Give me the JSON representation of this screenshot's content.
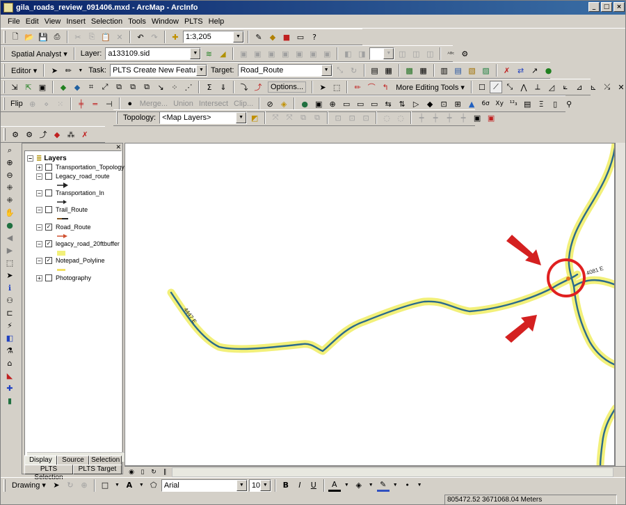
{
  "window": {
    "title": "gila_roads_review_091406.mxd - ArcMap - ArcInfo",
    "min": "_",
    "max": "□",
    "close": "×"
  },
  "menu": [
    "File",
    "Edit",
    "View",
    "Insert",
    "Selection",
    "Tools",
    "Window",
    "PLTS",
    "Help"
  ],
  "standard_toolbar": {
    "scale": "1:3,205"
  },
  "spatial_analyst": {
    "label": "Spatial Analyst ▾",
    "layer_label": "Layer:",
    "layer_value": "a133109.sid"
  },
  "editor": {
    "label": "Editor ▾",
    "task_label": "Task:",
    "task_value": "PLTS Create New Feature",
    "target_label": "Target:",
    "target_value": "Road_Route"
  },
  "edit_tools": {
    "options": "Options...",
    "more_editing": "More Editing Tools ▾"
  },
  "advanced_edit": {
    "flip": "Flip",
    "merge": "Merge...",
    "union": "Union",
    "intersect": "Intersect",
    "clip": "Clip..."
  },
  "topology": {
    "label": "Topology:",
    "value": "<Map Layers>"
  },
  "toc": {
    "root": "Layers",
    "layers": [
      {
        "name": "Transportation_Topology",
        "checked": false,
        "expanded": false
      },
      {
        "name": "Legacy_road_route",
        "checked": false,
        "expanded": true
      },
      {
        "name": "Transportation_ln",
        "checked": false,
        "expanded": true
      },
      {
        "name": "Trail_Route",
        "checked": false,
        "expanded": true
      },
      {
        "name": "Road_Route",
        "checked": true,
        "expanded": true
      },
      {
        "name": "legacy_road_20ftbuffer",
        "checked": true,
        "expanded": true
      },
      {
        "name": "Notepad_Polyline",
        "checked": true,
        "expanded": true
      },
      {
        "name": "Photography",
        "checked": false,
        "expanded": false
      }
    ],
    "tabs_row1": [
      "Display",
      "Source",
      "Selection"
    ],
    "tabs_row2": [
      "PLTS Selection",
      "PLTS Target"
    ]
  },
  "map": {
    "label_left": "4447 E",
    "label_right": "4081 E"
  },
  "drawing": {
    "label": "Drawing ▾",
    "font": "Arial",
    "size": "10",
    "bold": "B",
    "italic": "I",
    "underline": "U",
    "text_a": "A"
  },
  "status": {
    "coords": "805472.52  3671068.04 Meters"
  },
  "colors": {
    "road": "#2a6a8c",
    "buffer": "#f2f07a",
    "highlight_circle": "#e02020",
    "arrow": "#d42020"
  }
}
